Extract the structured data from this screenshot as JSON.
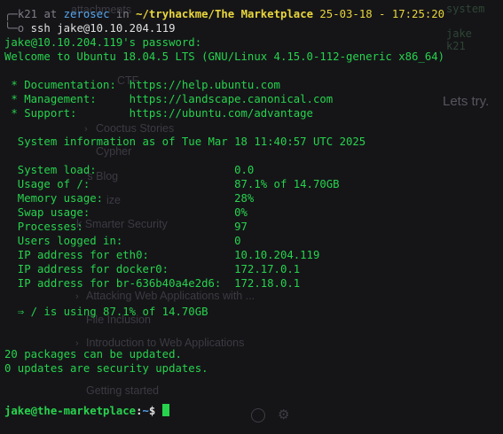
{
  "background_app": {
    "heading": "Lets try.",
    "terminal_fragment": [
      "system",
      "jake",
      "k21"
    ],
    "sidebar_items": [
      "attachments",
      "CTF",
      "Cooctus Stories",
      "Cypher",
      "'s Blog",
      "ize",
      "k Smarter Security",
      "Attacking Web Applications with ...",
      "File Inclusion",
      "Introduction to Web Applications",
      "Getting started"
    ]
  },
  "terminal": {
    "prompt_header": {
      "prefix": "╭─",
      "user": "k21",
      "at": "at",
      "host": "zerosec",
      "in": "in",
      "path": "~/tryhackme/The Marketplace",
      "datetime": "25-03-18 - 17:25:20"
    },
    "command_prefix": "╰─o",
    "command": "ssh jake@10.10.204.119",
    "lines": [
      "jake@10.10.204.119's password:",
      "Welcome to Ubuntu 18.04.5 LTS (GNU/Linux 4.15.0-112-generic x86_64)",
      "",
      " * Documentation:  https://help.ubuntu.com",
      " * Management:     https://landscape.canonical.com",
      " * Support:        https://ubuntu.com/advantage",
      "",
      "  System information as of Tue Mar 18 11:40:57 UTC 2025",
      "",
      "  System load:                     0.0",
      "  Usage of /:                      87.1% of 14.70GB",
      "  Memory usage:                    28%",
      "  Swap usage:                      0%",
      "  Processes:                       97",
      "  Users logged in:                 0",
      "  IP address for eth0:             10.10.204.119",
      "  IP address for docker0:          172.17.0.1",
      "  IP address for br-636b40a4e2d6:  172.18.0.1",
      "",
      "  ⇒ / is using 87.1% of 14.70GB",
      "",
      "",
      "20 packages can be updated.",
      "0 updates are security updates."
    ],
    "final_prompt": {
      "user_host": "jake@the-marketplace",
      "sep": ":",
      "path": "~",
      "symbol": "$"
    }
  }
}
